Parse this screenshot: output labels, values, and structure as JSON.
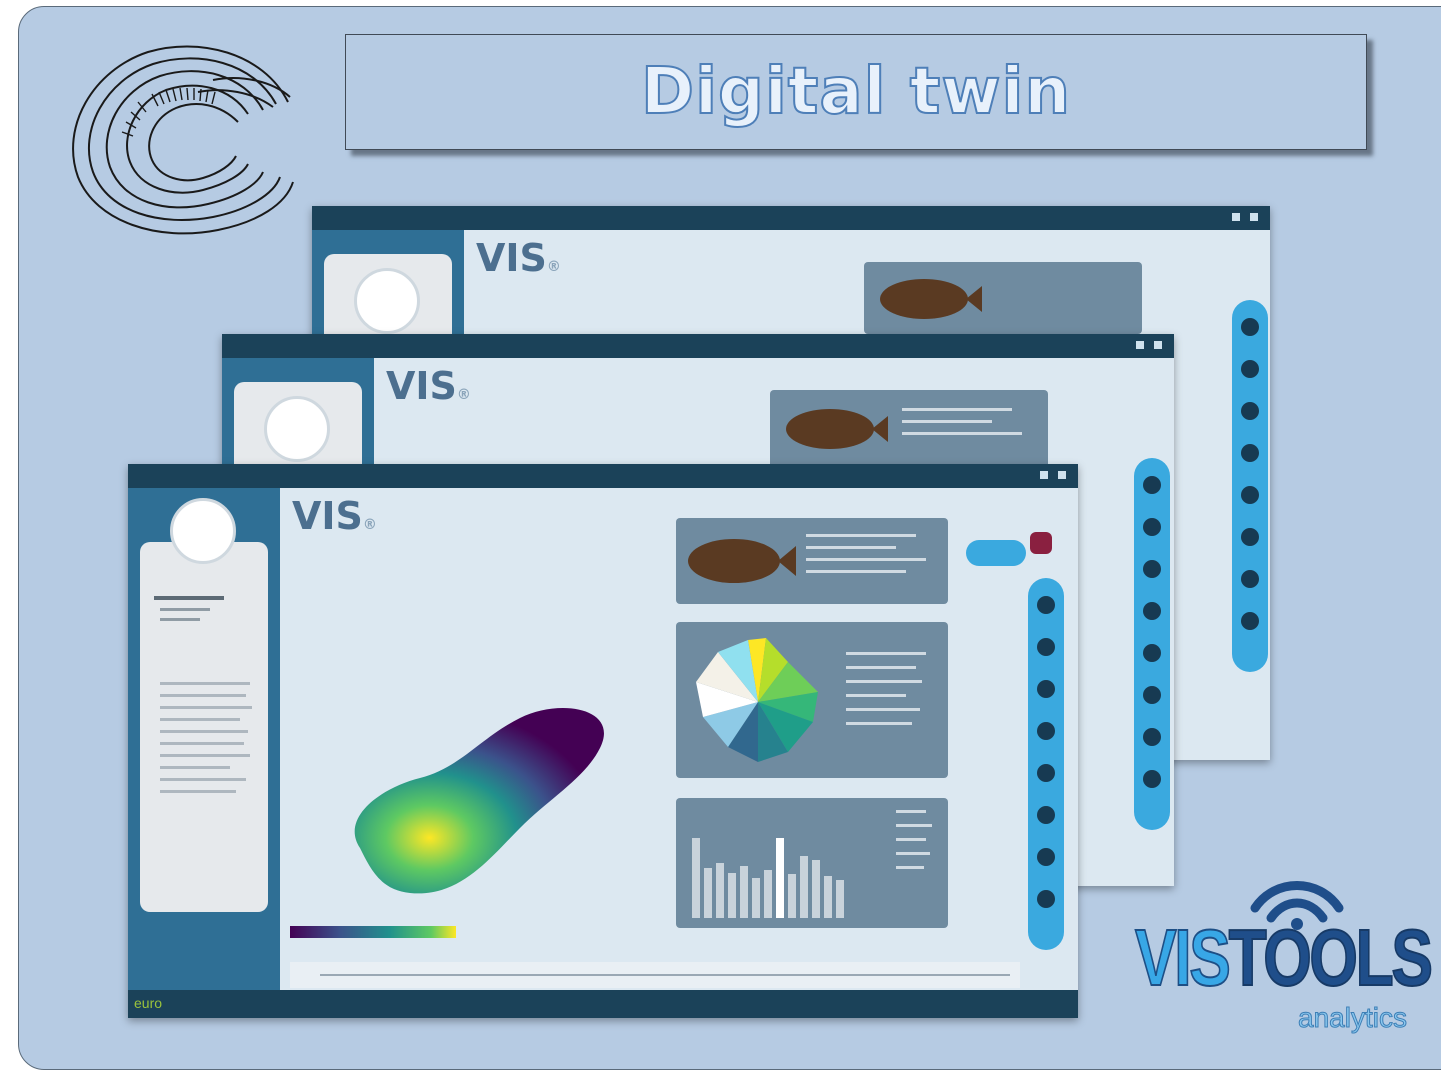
{
  "slide": {
    "title": "Digital twin",
    "background": "#b6cbe3"
  },
  "windows": [
    {
      "brand": "VIS",
      "avatar": "avatar-icon"
    },
    {
      "brand": "VIS",
      "avatar": "avatar-icon"
    },
    {
      "brand": "VIS",
      "avatar": "avatar-icon",
      "footer_text": "euro"
    }
  ],
  "branding": {
    "name_part1": "VIS",
    "name_part2": "TOOLS",
    "tagline": "analytics",
    "accent": "#38a7e6",
    "dark": "#1f4e8a"
  }
}
